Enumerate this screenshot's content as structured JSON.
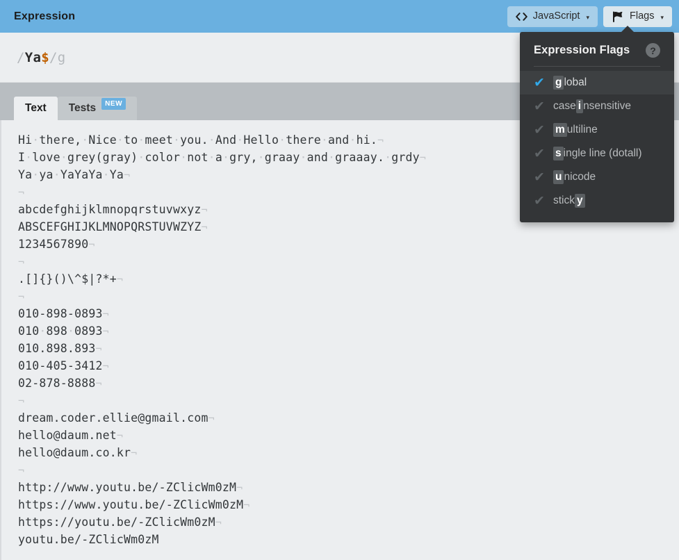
{
  "header": {
    "title": "Expression",
    "language_button": {
      "label": "JavaScript",
      "icon": "code-icon",
      "caret": "▾"
    },
    "flags_button": {
      "label": "Flags",
      "icon": "flag-icon",
      "caret": "▾"
    }
  },
  "expression": {
    "open_delim": "/",
    "body": "Ya",
    "anchor": "$",
    "close_delim": "/",
    "flags": "g",
    "full": "/Ya$/g"
  },
  "tabs": [
    {
      "label": "Text",
      "active": true,
      "badge": null
    },
    {
      "label": "Tests",
      "active": false,
      "badge": "NEW"
    }
  ],
  "flags_panel": {
    "title": "Expression Flags",
    "help_icon": "?",
    "items": [
      {
        "key": "g",
        "before": "",
        "after": "lobal",
        "enabled": true
      },
      {
        "key": "i",
        "before": "case ",
        "after": "nsensitive",
        "enabled": false
      },
      {
        "key": "m",
        "before": "",
        "after": "ultiline",
        "enabled": false
      },
      {
        "key": "s",
        "before": "",
        "after": "ingle line (dotall)",
        "enabled": false
      },
      {
        "key": "u",
        "before": "",
        "after": "nicode",
        "enabled": false
      },
      {
        "key": "y",
        "before": "stick",
        "after": "",
        "enabled": false
      }
    ]
  },
  "editor": {
    "lines": [
      "Hi·there,·Nice·to·meet·you.·And·Hello·there·and·hi.¬",
      "I·love·grey(gray)·color·not·a·gry,·graay·and·graaay.·grdy¬",
      "Ya·ya·YaYaYa·Ya¬",
      "¬",
      "abcdefghijklmnopqrstuvwxyz¬",
      "ABSCEFGHIJKLMNOPQRSTUVWZYZ¬",
      "1234567890¬",
      "¬",
      ".[]{}()\\^$|?*+¬",
      "¬",
      "010-898-0893¬",
      "010·898·0893¬",
      "010.898.893¬",
      "010-405-3412¬",
      "02-878-8888¬",
      "¬",
      "dream.coder.ellie@gmail.com¬",
      "hello@daum.net¬",
      "hello@daum.co.kr¬",
      "¬",
      "http://www.youtu.be/-ZClicWm0zM¬",
      "https://www.youtu.be/-ZClicWm0zM¬",
      "https://youtu.be/-ZClicWm0zM¬",
      "youtu.be/-ZClicWm0zM"
    ]
  },
  "colors": {
    "header_blue": "#6ab0e0",
    "tabbar_gray": "#b8bdc1",
    "editor_bg": "#eceef0",
    "panel_dark": "#333537",
    "accent_check": "#31a8e8",
    "anchor_orange": "#c06000"
  }
}
